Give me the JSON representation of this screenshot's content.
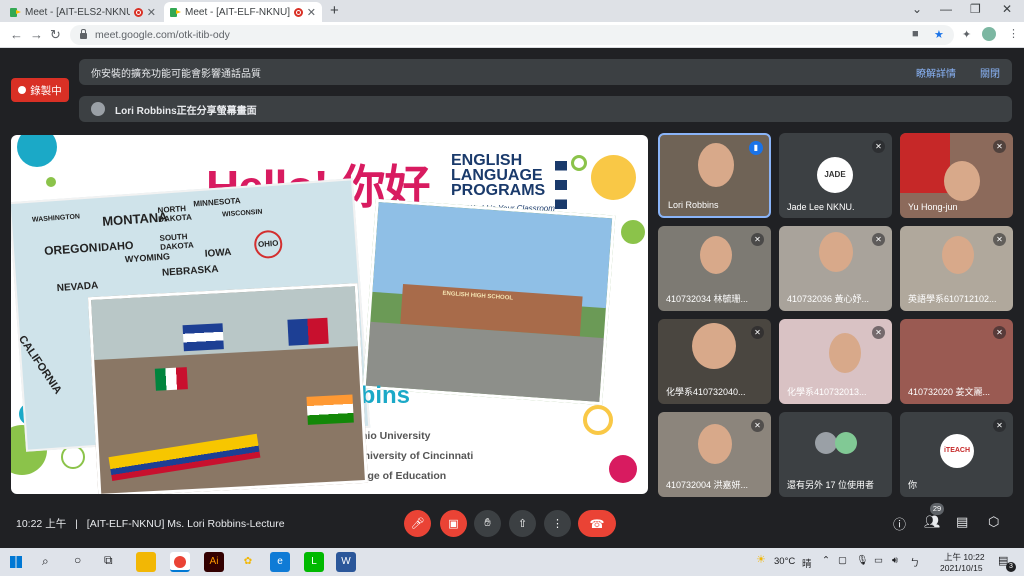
{
  "browser": {
    "tabs": [
      {
        "title": "Meet - [AIT-ELS2-NKNU] D"
      },
      {
        "title": "Meet - [AIT-ELF-NKNU] Ms"
      }
    ],
    "new_tab_glyph": "+",
    "url": "meet.google.com/otk-itib-ody",
    "window_controls": [
      "⌄",
      "—",
      "❐",
      "✕"
    ]
  },
  "meet": {
    "recording_label": "錄製中",
    "extension_banner": {
      "text": "你安裝的擴充功能可能會影響通話品質",
      "learn_more": "瞭解詳情",
      "close": "關閉"
    },
    "presenting_banner": {
      "text": "Lori Robbins正在分享螢幕畫面"
    },
    "slide": {
      "hello": "Hello! 你好",
      "elp_lines": [
        "ENGLISH",
        "LANGUAGE",
        "PROGRAMS"
      ],
      "elp_tagline": "The World is Your Classroom",
      "map_states": [
        "WASHINGTON",
        "MONTANA",
        "NORTH DAKOTA",
        "MINNESOTA",
        "WISCONSIN",
        "SOUTH DAKOTA",
        "OREGON",
        "IDAHO",
        "WYOMING",
        "IOWA",
        "OHIO",
        "NEBRASKA",
        "NEVADA",
        "CALIFORNIA"
      ],
      "school_sign": "ENGLISH HIGH SCHOOL",
      "robbins": "bbins",
      "credits": [
        "hio University",
        "University of Cincinnati",
        "American College of Education"
      ]
    },
    "participants": [
      {
        "name": "Lori Robbins",
        "speaking": true
      },
      {
        "name": "Jade Lee NKNU.",
        "avatar_text": "JADE"
      },
      {
        "name": "Yu Hong-jun"
      },
      {
        "name": "410732034 林毓珊..."
      },
      {
        "name": "410732036 黃心妤..."
      },
      {
        "name": "英語學系610712102..."
      },
      {
        "name": "化學系410732040..."
      },
      {
        "name": "化學系410732013..."
      },
      {
        "name": "410732020 姜文麗..."
      },
      {
        "name": "410732004 洪嘉妍..."
      },
      {
        "name": "還有另外 17 位使用者"
      },
      {
        "name": "你",
        "avatar_text": "iTEACH"
      }
    ],
    "mic_muted_icon": "✕",
    "meeting_time": "10:22 上午",
    "meeting_title": "[AIT-ELF-NKNU] Ms. Lori Robbins-Lecture",
    "participant_count": "29"
  },
  "taskbar": {
    "weather": "30°C",
    "weather_desc": "晴",
    "time": "上午 10:22",
    "date": "2021/10/15",
    "notifications": "3"
  },
  "colors": {
    "meet_bg": "#202124",
    "tile_bg": "#3c4043",
    "danger": "#ea4335",
    "link": "#8ab4f8",
    "hello_pink": "#d81b60",
    "elp_navy": "#1a3a6b"
  }
}
